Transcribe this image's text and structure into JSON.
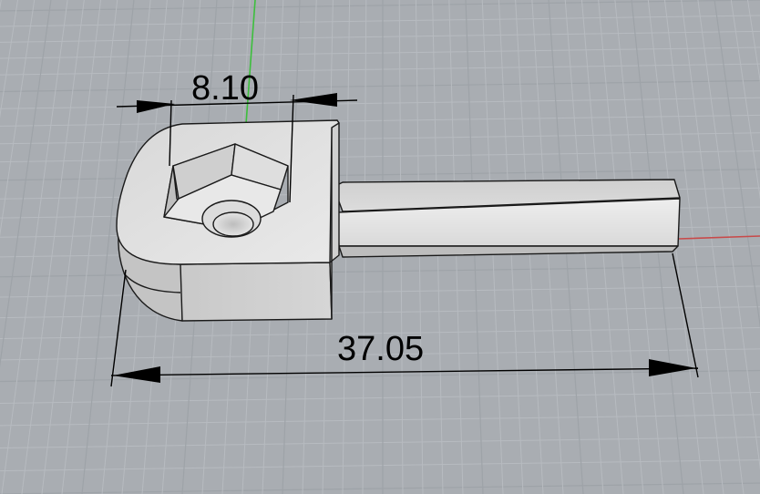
{
  "viewport": {
    "background": "#a9adb2",
    "grid_minor_color": "#b7bbc0",
    "grid_major_color": "#9ea3a8",
    "y_axis_color": "#3cbf3c",
    "x_axis_color": "#c84a4a"
  },
  "model": {
    "face_color": "#e6e6e6",
    "edge_color": "#1a1a1a"
  },
  "dimensions": {
    "width_label": "8.10",
    "length_label": "37.05"
  }
}
